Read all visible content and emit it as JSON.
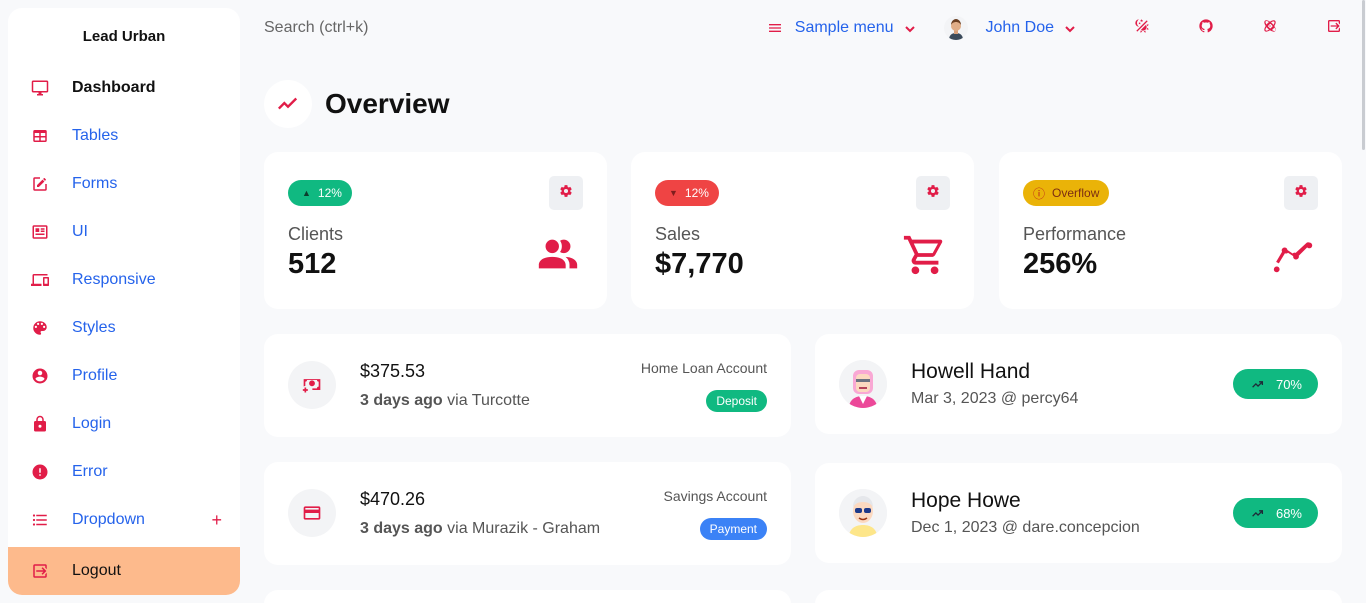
{
  "app": {
    "brand": "Lead Urban"
  },
  "sidebar": {
    "items": [
      {
        "label": "Dashboard",
        "icon": "monitor-icon"
      },
      {
        "label": "Tables",
        "icon": "table-icon"
      },
      {
        "label": "Forms",
        "icon": "edit-icon"
      },
      {
        "label": "UI",
        "icon": "ui-card-icon"
      },
      {
        "label": "Responsive",
        "icon": "responsive-icon"
      },
      {
        "label": "Styles",
        "icon": "palette-icon"
      },
      {
        "label": "Profile",
        "icon": "account-circle-icon"
      },
      {
        "label": "Login",
        "icon": "lock-icon"
      },
      {
        "label": "Error",
        "icon": "alert-circle-icon"
      },
      {
        "label": "Dropdown",
        "icon": "list-icon",
        "expand": "+"
      }
    ],
    "logout_label": "Logout"
  },
  "topbar": {
    "search_placeholder": "Search (ctrl+k)",
    "menu_label": "Sample menu",
    "user_name": "John Doe"
  },
  "page": {
    "title": "Overview"
  },
  "stats": [
    {
      "label": "Clients",
      "value": "512",
      "trend": "12%",
      "trend_type": "up",
      "color": "#10b981",
      "icon": "users-icon"
    },
    {
      "label": "Sales",
      "value": "$7,770",
      "trend": "12%",
      "trend_type": "down",
      "color": "#ef4444",
      "icon": "cart-icon"
    },
    {
      "label": "Performance",
      "value": "256%",
      "trend": "Overflow",
      "trend_type": "alert",
      "color": "#eab308",
      "icon": "chart-line-icon"
    }
  ],
  "transactions": [
    {
      "amount": "$375.53",
      "when": "3 days ago",
      "via": "via Turcotte",
      "account": "Home Loan Account",
      "type": "Deposit",
      "type_color": "#10b981",
      "icon": "cash-plus-icon"
    },
    {
      "amount": "$470.26",
      "when": "3 days ago",
      "via": "via Murazik - Graham",
      "account": "Savings Account",
      "type": "Payment",
      "type_color": "#3b82f6",
      "icon": "credit-card-icon"
    }
  ],
  "people": [
    {
      "name": "Howell Hand",
      "meta": "Mar 3, 2023 @ percy64",
      "progress": "70%"
    },
    {
      "name": "Hope Howe",
      "meta": "Dec 1, 2023 @ dare.concepcion",
      "progress": "68%"
    }
  ]
}
